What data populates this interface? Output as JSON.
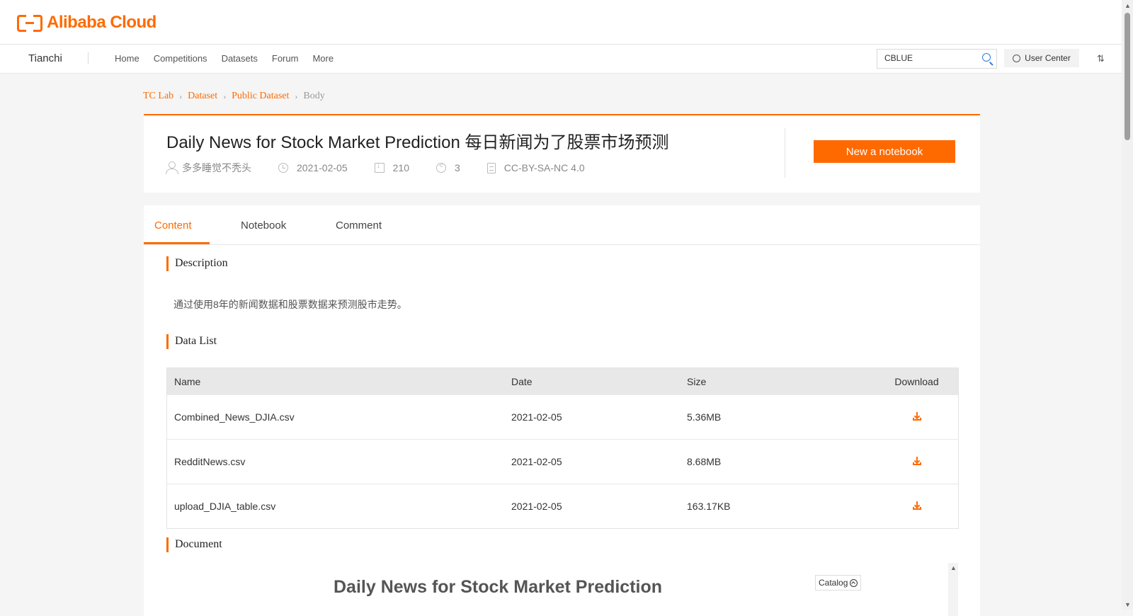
{
  "header": {
    "logo_text": "Alibaba Cloud"
  },
  "nav": {
    "brand": "Tianchi",
    "links": [
      "Home",
      "Competitions",
      "Datasets",
      "Forum",
      "More"
    ],
    "search_value": "CBLUE",
    "user_center": "User Center"
  },
  "breadcrumb": {
    "items": [
      "TC Lab",
      "Dataset",
      "Public Dataset"
    ],
    "current": "Body"
  },
  "dataset": {
    "title": "Daily News for Stock Market Prediction 每日新闻为了股票市场预测",
    "author": "多多睡觉不秃头",
    "date": "2021-02-05",
    "downloads": "210",
    "shares": "3",
    "license": "CC-BY-SA-NC 4.0",
    "new_notebook": "New a notebook"
  },
  "tabs": [
    "Content",
    "Notebook",
    "Comment"
  ],
  "sections": {
    "description_title": "Description",
    "description_text": "通过使用8年的新闻数据和股票数据来预测股市走势。",
    "data_list_title": "Data List",
    "document_title": "Document"
  },
  "table": {
    "headers": [
      "Name",
      "Date",
      "Size",
      "Download"
    ],
    "rows": [
      {
        "name": "Combined_News_DJIA.csv",
        "date": "2021-02-05",
        "size": "5.36MB"
      },
      {
        "name": "RedditNews.csv",
        "date": "2021-02-05",
        "size": "8.68MB"
      },
      {
        "name": "upload_DJIA_table.csv",
        "date": "2021-02-05",
        "size": "163.17KB"
      }
    ]
  },
  "document": {
    "heading": "Daily News for Stock Market Prediction",
    "catalog": "Catalog"
  },
  "colors": {
    "accent": "#ff6a00"
  }
}
